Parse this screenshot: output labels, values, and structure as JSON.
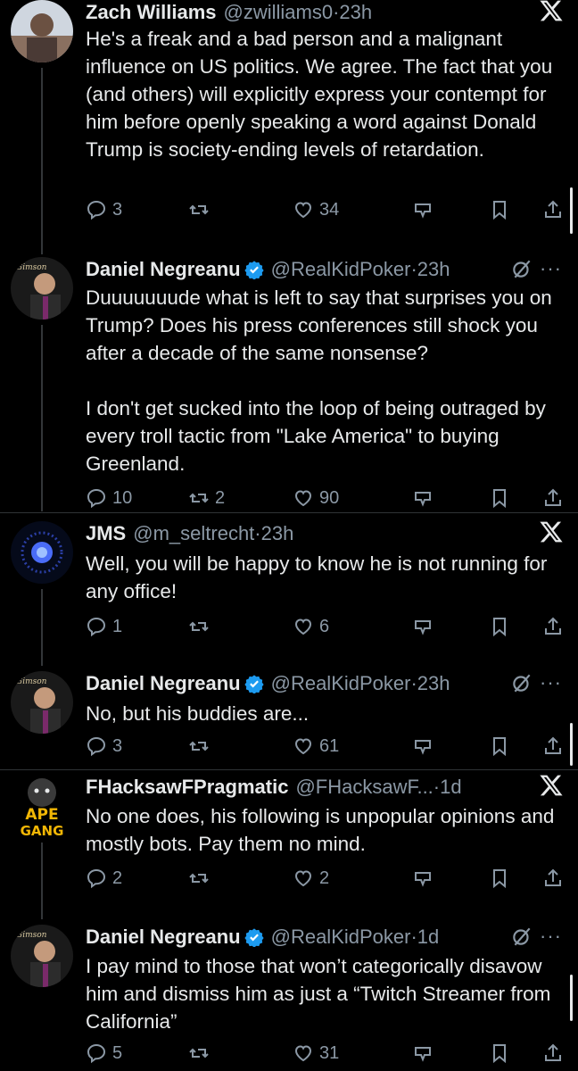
{
  "tweets": [
    {
      "name": "Zach Williams",
      "handle": "@zwilliams0",
      "time": "23h",
      "text": "He's a freak and a bad person and a malignant influence on US politics. We agree. The fact that you (and others) will explicitly express your contempt for him before openly speaking a word against Donald Trump is society-ending levels of retardation.",
      "replies": "3",
      "reposts": "",
      "likes": "34"
    },
    {
      "name": "Daniel Negreanu",
      "handle": "@RealKidPoker",
      "time": "23h",
      "text": "Duuuuuuude what is left to say that surprises you on Trump? Does his press conferences still shock you after a decade of the same nonsense?\n\nI don't get sucked into the loop of being outraged by every troll tactic from \"Lake America\" to buying Greenland.",
      "replies": "10",
      "reposts": "2",
      "likes": "90"
    },
    {
      "name": "JMS",
      "handle": "@m_seltrecht",
      "time": "23h",
      "text": "Well, you will be happy to know he is not running for any office!",
      "replies": "1",
      "reposts": "",
      "likes": "6"
    },
    {
      "name": "Daniel Negreanu",
      "handle": "@RealKidPoker",
      "time": "23h",
      "text": "No, but his buddies are...",
      "replies": "3",
      "reposts": "",
      "likes": "61"
    },
    {
      "name": "FHacksawFPragmatic",
      "handle": "@FHacksawF...",
      "time": "1d",
      "text": "No one does, his following is unpopular opinions and mostly bots. Pay them no mind.",
      "replies": "2",
      "reposts": "",
      "likes": "2"
    },
    {
      "name": "Daniel Negreanu",
      "handle": "@RealKidPoker",
      "time": "1d",
      "text": "I pay mind to those that won’t categorically disavow him and dismiss him as just a “Twitch Streamer from California”",
      "replies": "5",
      "reposts": "",
      "likes": "31"
    }
  ],
  "avatars": {
    "ape_logo_text_1": "APE",
    "ape_logo_text_2": "GANG",
    "daniel_logo_text": "Gimson"
  },
  "separator": " · ",
  "more_label": "···",
  "colors": {
    "text": "#e7e9ea",
    "muted": "#8b98a5",
    "verified": "#1d9bf0",
    "background": "#000000"
  },
  "icons": [
    "reply-icon",
    "repost-icon",
    "like-icon",
    "grok-icon",
    "bookmark-icon",
    "share-icon",
    "x-logo-icon",
    "verified-badge-icon"
  ]
}
